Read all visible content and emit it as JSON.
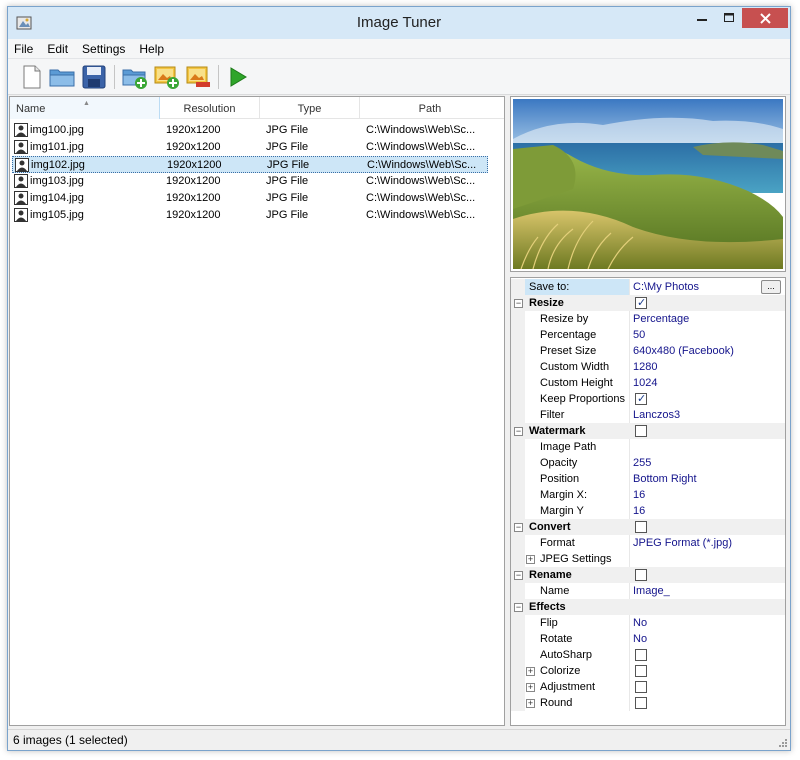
{
  "window": {
    "title": "Image Tuner",
    "minimize_label": "–",
    "maximize_label": "□",
    "close_label": "✕"
  },
  "menu": [
    "File",
    "Edit",
    "Settings",
    "Help"
  ],
  "toolbar": {
    "icons": [
      "new-document-icon",
      "open-folder-icon",
      "save-icon",
      "add-folder-icon",
      "add-image-icon",
      "remove-image-icon",
      "run-icon"
    ]
  },
  "filelist": {
    "columns": {
      "name": "Name",
      "resolution": "Resolution",
      "type": "Type",
      "path": "Path"
    },
    "rows": [
      {
        "name": "img100.jpg",
        "resolution": "1920x1200",
        "type": "JPG File",
        "path": "C:\\Windows\\Web\\Sc..."
      },
      {
        "name": "img101.jpg",
        "resolution": "1920x1200",
        "type": "JPG File",
        "path": "C:\\Windows\\Web\\Sc..."
      },
      {
        "name": "img102.jpg",
        "resolution": "1920x1200",
        "type": "JPG File",
        "path": "C:\\Windows\\Web\\Sc..."
      },
      {
        "name": "img103.jpg",
        "resolution": "1920x1200",
        "type": "JPG File",
        "path": "C:\\Windows\\Web\\Sc..."
      },
      {
        "name": "img104.jpg",
        "resolution": "1920x1200",
        "type": "JPG File",
        "path": "C:\\Windows\\Web\\Sc..."
      },
      {
        "name": "img105.jpg",
        "resolution": "1920x1200",
        "type": "JPG File",
        "path": "C:\\Windows\\Web\\Sc..."
      }
    ],
    "selected_index": 2
  },
  "props": {
    "save_to": {
      "label": "Save to:",
      "value": "C:\\My Photos",
      "browse": "..."
    },
    "resize": {
      "label": "Resize",
      "enabled": true,
      "resize_by": {
        "label": "Resize by",
        "value": "Percentage"
      },
      "percentage": {
        "label": "Percentage",
        "value": "50"
      },
      "preset_size": {
        "label": "Preset Size",
        "value": "640x480 (Facebook)"
      },
      "custom_width": {
        "label": "Custom Width",
        "value": "1280"
      },
      "custom_height": {
        "label": "Custom Height",
        "value": "1024"
      },
      "keep_proportions": {
        "label": "Keep Proportions",
        "checked": true
      },
      "filter": {
        "label": "Filter",
        "value": "Lanczos3"
      }
    },
    "watermark": {
      "label": "Watermark",
      "enabled": false,
      "image_path": {
        "label": "Image Path",
        "value": ""
      },
      "opacity": {
        "label": "Opacity",
        "value": "255"
      },
      "position": {
        "label": "Position",
        "value": "Bottom Right"
      },
      "margin_x": {
        "label": "Margin X:",
        "value": "16"
      },
      "margin_y": {
        "label": "Margin Y",
        "value": "16"
      }
    },
    "convert": {
      "label": "Convert",
      "enabled": false,
      "format": {
        "label": "Format",
        "value": "JPEG Format (*.jpg)"
      },
      "jpeg_settings": {
        "label": "JPEG Settings"
      }
    },
    "rename": {
      "label": "Rename",
      "enabled": false,
      "name": {
        "label": "Name",
        "value": "Image_"
      }
    },
    "effects": {
      "label": "Effects",
      "flip": {
        "label": "Flip",
        "value": "No"
      },
      "rotate": {
        "label": "Rotate",
        "value": "No"
      },
      "autosharp": {
        "label": "AutoSharp",
        "checked": false
      },
      "colorize": {
        "label": "Colorize",
        "checked": false
      },
      "adjustment": {
        "label": "Adjustment",
        "checked": false
      },
      "round": {
        "label": "Round",
        "checked": false
      }
    }
  },
  "status": {
    "text": "6 images (1 selected)"
  },
  "colors": {
    "window_frame": "#d6e8f7",
    "close_button": "#c75050",
    "selection": "#cde6f7",
    "value_text": "#14148c"
  }
}
